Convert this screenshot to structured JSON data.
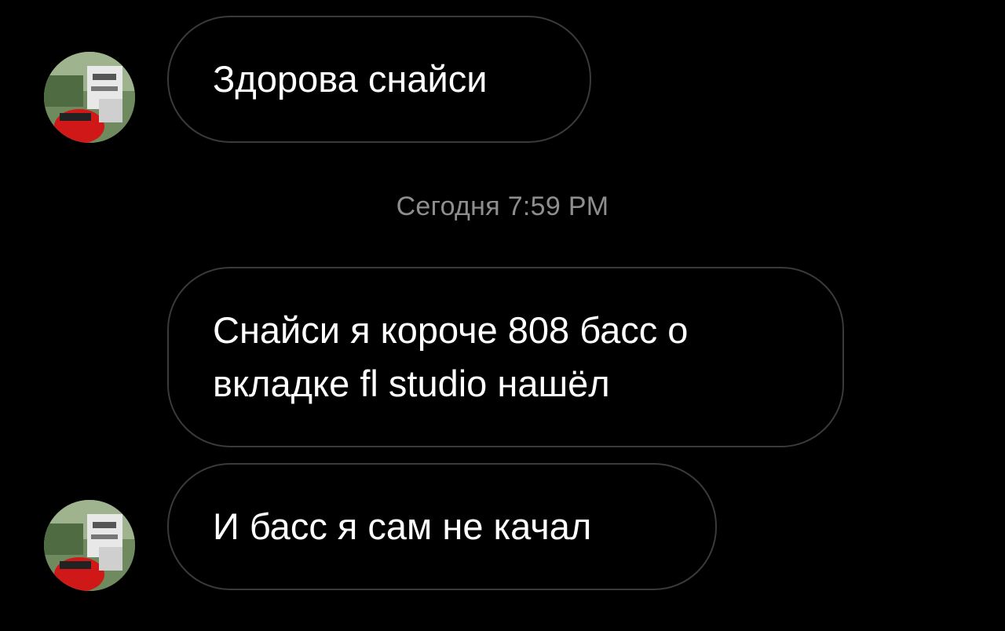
{
  "colors": {
    "background": "#000000",
    "bubble_border": "#3a3a3a",
    "message_text": "#ffffff",
    "timestamp_text": "#8e8e8e"
  },
  "messages": [
    {
      "text": "Здорова снайси",
      "has_avatar": true
    },
    {
      "text": "Снайси я короче 808 басс о\nвкладке fl studio нашёл",
      "has_avatar": false
    },
    {
      "text": "И басс я сам не качал",
      "has_avatar": true
    }
  ],
  "timestamp": "Сегодня 7:59 PM",
  "avatar_icon": "user-avatar-photo"
}
